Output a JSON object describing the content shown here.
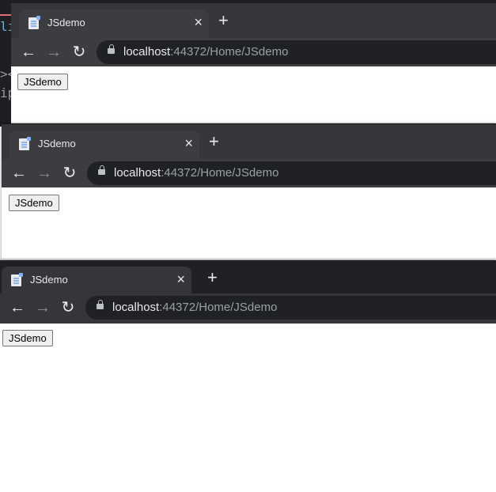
{
  "windows": [
    {
      "tab": {
        "title": "JSdemo",
        "close": "×",
        "new_tab": "+"
      },
      "nav": {
        "back": "←",
        "forward": "→",
        "reload": "↻"
      },
      "address": {
        "host": "localhost",
        "rest": ":44372/Home/JSdemo"
      },
      "page": {
        "button_label": "JSdemo"
      }
    },
    {
      "tab": {
        "title": "JSdemo",
        "close": "×",
        "new_tab": "+"
      },
      "nav": {
        "back": "←",
        "forward": "→",
        "reload": "↻"
      },
      "address": {
        "host": "localhost",
        "rest": ":44372/Home/JSdemo"
      },
      "page": {
        "button_label": "JSdemo"
      }
    },
    {
      "tab": {
        "title": "JSdemo",
        "close": "×",
        "new_tab": "+"
      },
      "nav": {
        "back": "←",
        "forward": "→",
        "reload": "↻"
      },
      "address": {
        "host": "localhost",
        "rest": ":44372/Home/JSdemo"
      },
      "page": {
        "button_label": "JSdemo"
      }
    }
  ],
  "backdrop_code": {
    "line1": "li",
    "line2": "><",
    "line3": "ip"
  },
  "colors": {
    "tabstrip": "#35363a",
    "omnibox": "#202124",
    "accent": "#8ab4f8"
  }
}
